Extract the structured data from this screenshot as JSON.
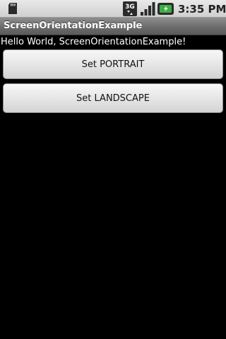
{
  "status_bar": {
    "time": "3:35 PM",
    "network_label": "3G",
    "icons": [
      "sd-card-icon",
      "3g-data-icon",
      "signal-strength-icon",
      "battery-charging-icon"
    ],
    "background": "#dcdcdc"
  },
  "title_bar": {
    "title": "ScreenOrientationExample"
  },
  "content": {
    "hello_text": "Hello World, ScreenOrientationExample!",
    "buttons": [
      {
        "label": "Set PORTRAIT"
      },
      {
        "label": "Set LANDSCAPE"
      }
    ]
  },
  "colors": {
    "background": "#000000",
    "text": "#ffffff",
    "battery_green": "#3cb043"
  }
}
